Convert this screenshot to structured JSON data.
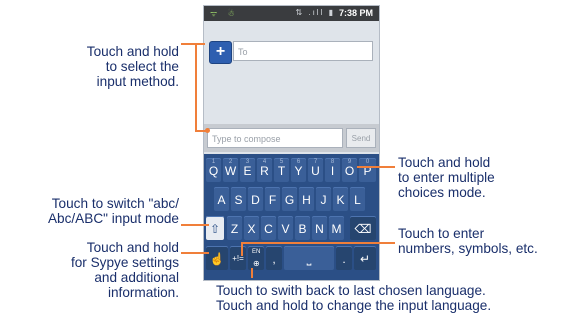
{
  "status_bar": {
    "time": "7:38 PM",
    "left_icons": "ᯤ ☃",
    "right_icons": "⇅ .ıll ▮"
  },
  "message": {
    "to_placeholder": "To",
    "compose_placeholder": "Type to compose",
    "send_label": "Send"
  },
  "keyboard": {
    "row1": [
      "Q",
      "W",
      "E",
      "R",
      "T",
      "Y",
      "U",
      "I",
      "O",
      "P"
    ],
    "row1_nums": [
      "1",
      "2",
      "3",
      "4",
      "5",
      "6",
      "7",
      "8",
      "9",
      "0"
    ],
    "row2": [
      "A",
      "S",
      "D",
      "F",
      "G",
      "H",
      "J",
      "K",
      "L"
    ],
    "row3": [
      "Z",
      "X",
      "C",
      "V",
      "B",
      "N",
      "M"
    ],
    "row4": {
      "sym": "+!=",
      "lang": "EN",
      "comma": ",",
      "period": "."
    }
  },
  "callouts": {
    "input_method": [
      "Touch and hold",
      "to select the",
      "input method."
    ],
    "abc_mode": [
      "Touch to switch \"abc/",
      "Abc/ABC\" input mode"
    ],
    "settings": [
      "Touch and hold",
      "for Sypye settings",
      "and additional",
      "information."
    ],
    "multiple_choices": [
      "Touch and hold",
      "to enter multiple",
      "choices mode."
    ],
    "numbers": [
      "Touch to enter",
      "numbers, symbols, etc."
    ],
    "language": [
      "Touch to swith back to last chosen language.",
      "Touch and hold to change the input language."
    ]
  },
  "colors": {
    "accent": "#f07f3a",
    "callout_text": "#1a2f6b",
    "keyboard_bg": "#2b4f86"
  }
}
